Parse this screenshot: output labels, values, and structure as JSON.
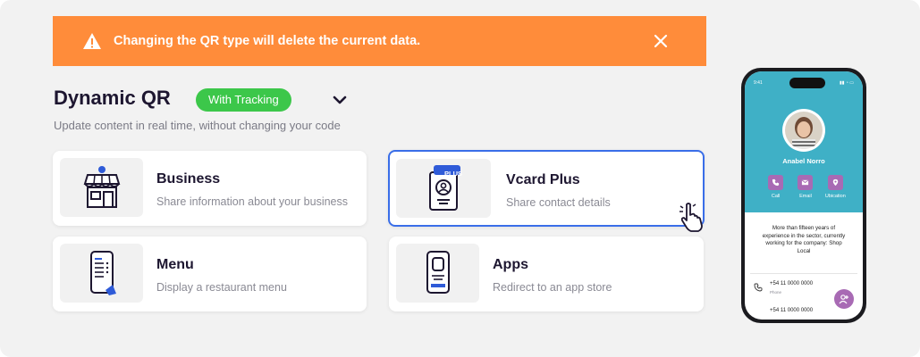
{
  "alert": {
    "message": "Changing the QR type will delete the current data."
  },
  "header": {
    "title": "Dynamic QR",
    "badge": "With Tracking",
    "subtitle": "Update content in real time, without changing your code"
  },
  "cards": [
    {
      "title": "Business",
      "description": "Share information about your business",
      "icon": "store-icon"
    },
    {
      "title": "Vcard Plus",
      "description": "Share contact details",
      "icon": "vcard-icon",
      "tag": "PLUS",
      "selected": true
    },
    {
      "title": "Menu",
      "description": "Display a restaurant menu",
      "icon": "menu-phone-icon"
    },
    {
      "title": "Apps",
      "description": "Redirect to an app store",
      "icon": "app-phone-icon"
    }
  ],
  "preview": {
    "time": "9:41",
    "name": "Anabel Norro",
    "actions": [
      "Call",
      "Email",
      "Ubication"
    ],
    "about": "More than fifteen years of experience in the sector, currently working for the company: Shop Local",
    "phone1": "+54 11 0000 0000",
    "phone_label": "Phone",
    "phone2": "+54 11 0000 0000"
  },
  "colors": {
    "alert": "#ff8c3a",
    "badge": "#3cc74a",
    "selected_border": "#3a6ee8",
    "accent_blue": "#2f5bd8",
    "preview_teal": "#3fb0c6",
    "preview_purple": "#a86ab4"
  }
}
